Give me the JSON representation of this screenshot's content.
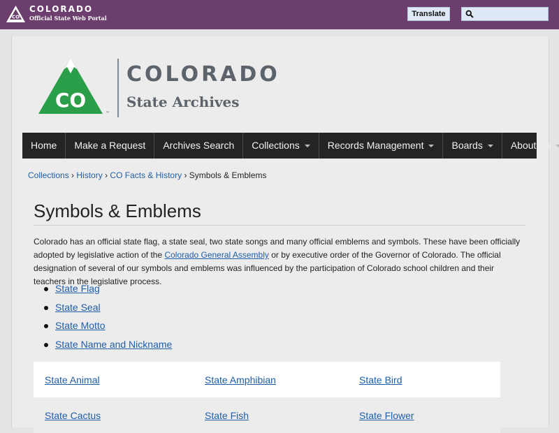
{
  "portal": {
    "title": "COLORADO",
    "subtitle": "Official State Web Portal",
    "logo_text": "CO"
  },
  "header_tools": {
    "translate_label": "Translate",
    "search_placeholder": ""
  },
  "site": {
    "logo_text": "CO",
    "logo_mark": "™",
    "name": "COLORADO",
    "subtitle": "State Archives"
  },
  "nav": {
    "items": [
      {
        "label": "Home"
      },
      {
        "label": "Make a Request"
      },
      {
        "label": "Archives Search"
      },
      {
        "label": "Collections"
      },
      {
        "label": "Records Management"
      },
      {
        "label": "Boards"
      },
      {
        "label": "About Us"
      }
    ]
  },
  "breadcrumb": {
    "items": [
      "Collections",
      "History",
      "CO Facts & History"
    ],
    "separator": "›",
    "current": "Symbols & Emblems"
  },
  "page": {
    "title": "Symbols & Emblems",
    "intro_part1": "Colorado has an official state flag, a state seal, two state songs and many official emblems and symbols. These have been officially adopted by legislative action of the ",
    "intro_link": "Colorado General Assembly",
    "intro_part2": " or by executive order of the Governor of Colorado. The official designation of several of our symbols and emblems was influenced by the participation of Colorado school children and their teachers in the legislative process."
  },
  "symbols": {
    "items": [
      "State Flag",
      "State Seal",
      "State Motto",
      "State Name and Nickname"
    ]
  },
  "emblems": {
    "rows": [
      [
        "State Animal",
        "State Amphibian",
        "State Bird"
      ],
      [
        "State Cactus",
        "State Fish",
        "State Flower"
      ]
    ]
  },
  "colors": {
    "topbar": "#6b3e6d",
    "logo_green": "#2a9e48",
    "link": "#1f5ea8",
    "nav_bg": "#242424"
  }
}
